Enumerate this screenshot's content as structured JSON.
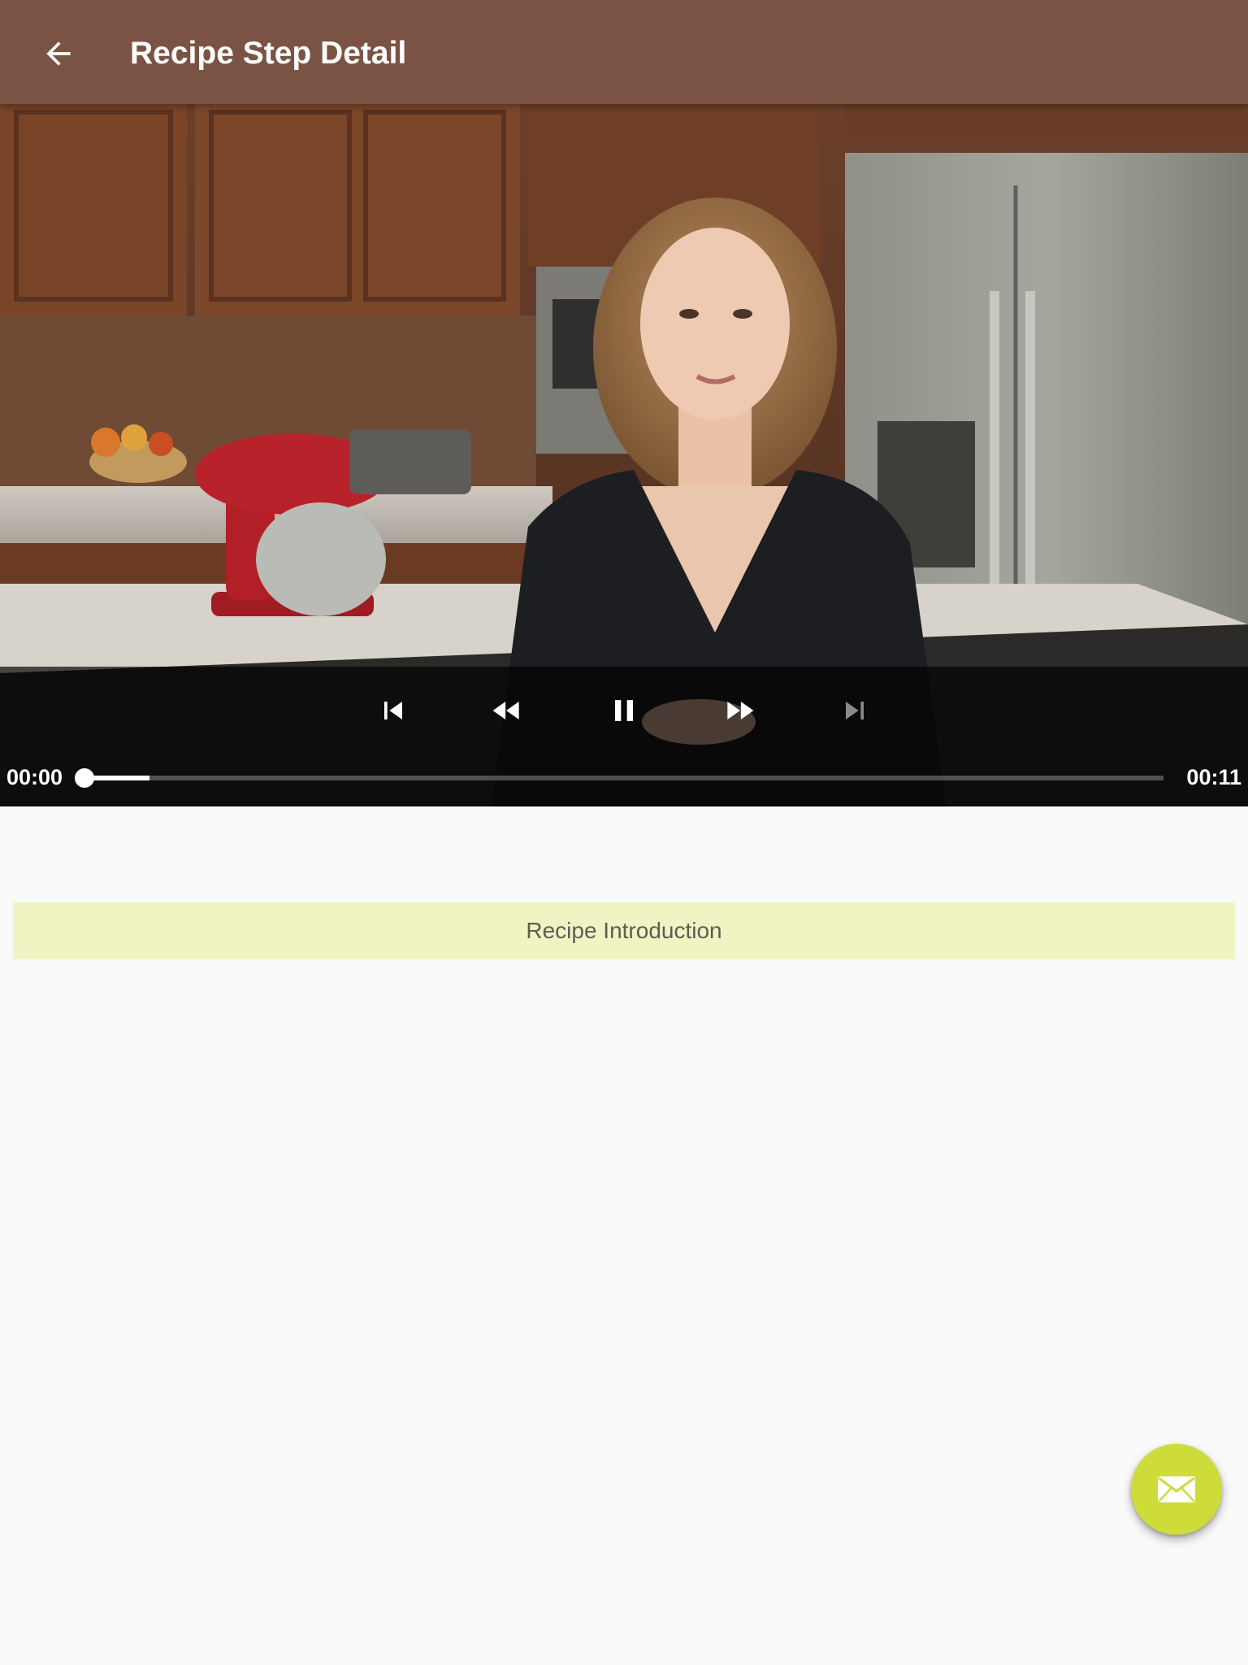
{
  "app_bar": {
    "title": "Recipe Step Detail",
    "back_icon": "arrow-back-icon"
  },
  "player": {
    "current_time": "00:00",
    "duration": "00:11",
    "progress_fraction": 0.0,
    "buffered_fraction": 0.06,
    "controls": [
      "skip-previous-icon",
      "rewind-icon",
      "pause-icon",
      "fast-forward-icon",
      "skip-next-icon"
    ]
  },
  "step": {
    "description": "Recipe Introduction"
  },
  "fab": {
    "icon": "email-icon"
  },
  "colors": {
    "app_bar": "#7b5344",
    "description_bg": "#f0f4c3",
    "fab": "#cddc39"
  }
}
